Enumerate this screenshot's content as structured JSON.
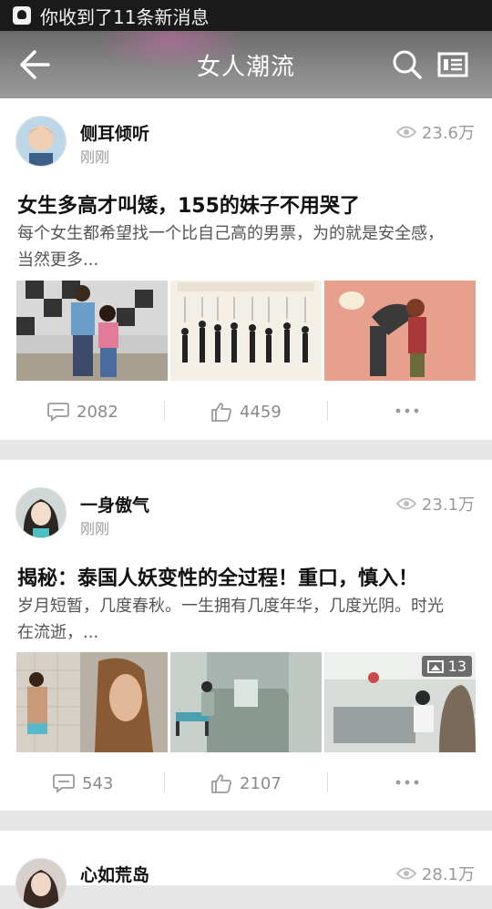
{
  "status_bar": {
    "notification": "你收到了11条新消息",
    "icon": "qq-bell-icon"
  },
  "header": {
    "title": "女人潮流",
    "back_icon": "arrow-left-icon",
    "search_icon": "search-icon",
    "menu_icon": "list-icon"
  },
  "feed": [
    {
      "author": "侧耳倾听",
      "time": "刚刚",
      "views": "23.6万",
      "title": "女生多高才叫矮，155的妹子不用哭了",
      "summary": "每个女生都希望找一个比自己高的男票，为的就是安全感，当然更多...",
      "comments": "2082",
      "likes": "4459"
    },
    {
      "author": "一身傲气",
      "time": "刚刚",
      "views": "23.1万",
      "title": "揭秘：泰国人妖变性的全过程！重口，慎入！",
      "summary": "岁月短暂，几度春秋。一生拥有几度年华，几度光阴。时光在流逝，...",
      "comments": "543",
      "likes": "2107",
      "image_count": "13"
    },
    {
      "author": "心如荒岛",
      "views": "28.1万"
    }
  ],
  "colors": {
    "accent_text": "#111111",
    "muted": "#9a9a9a",
    "separator": "#e6e6e6"
  }
}
